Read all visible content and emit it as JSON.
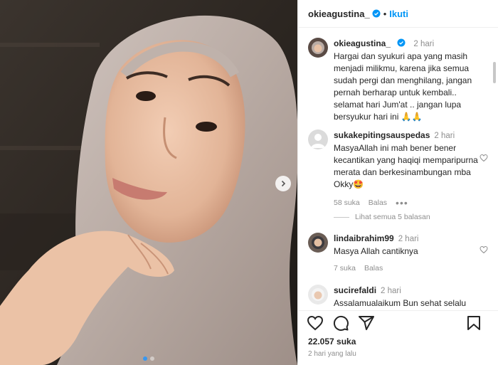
{
  "post": {
    "username": "okieagustina_",
    "follow_label": "Ikuti",
    "separator": "•",
    "likes_count": "22.057 suka",
    "posted_ago": "2 hari yang lalu",
    "carousel": {
      "total_slides": 2,
      "active_slide": 1
    }
  },
  "caption": {
    "username": "okieagustina_",
    "time": "2 hari",
    "text": "Hargai dan syukuri apa yang masih menjadi milikmu, karena jika semua sudah pergi dan menghilang, jangan pernah berharap untuk kembali.. selamat hari Jum'at .. jangan lupa bersyukur hari ini 🙏🙏"
  },
  "comments": [
    {
      "username": "sukakepitingsauspedas",
      "time": "2 hari",
      "text": "MasyaAllah ini mah bener bener kecantikan yang haqiqi memparipurna merata dan berkesinambungan mba Okky🤩",
      "likes": "58 suka",
      "reply_label": "Balas",
      "more": "•••",
      "see_replies": "Lihat semua 5 balasan"
    },
    {
      "username": "lindaibrahim99",
      "time": "2 hari",
      "text": "Masya Allah cantiknya",
      "likes": "7 suka",
      "reply_label": "Balas"
    },
    {
      "username": "sucirefaldi",
      "time": "2 hari",
      "text": "Assalamualaikum Bun sehat selalu"
    }
  ],
  "icons": {
    "verified": "verified-badge-icon",
    "like": "heart-icon",
    "comment": "comment-bubble-icon",
    "share": "paper-plane-icon",
    "save": "bookmark-icon",
    "next": "chevron-right-icon"
  },
  "colors": {
    "accent": "#0095f6",
    "text": "#262626",
    "muted": "#8e8e8e",
    "border": "#efefef"
  }
}
